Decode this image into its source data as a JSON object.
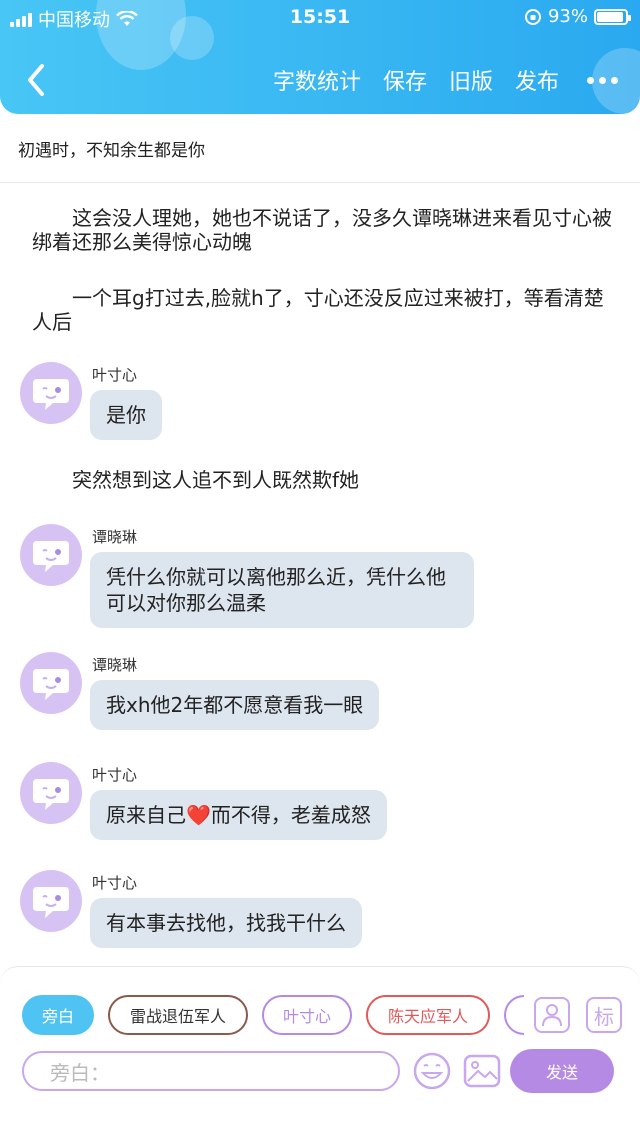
{
  "status_bar": {
    "carrier": "中国移动",
    "time": "15:51",
    "battery": "93%",
    "battery_level": 0.93
  },
  "header": {
    "actions": [
      "字数统计",
      "保存",
      "旧版",
      "发布"
    ]
  },
  "chapter_title": "初遇时，不知余生都是你",
  "narrations": [
    "这会没人理她，她也不说话了，没多久谭晓琳进来看见寸心被绑着还那么美得惊心动魄",
    "一个耳g打过去,脸就h了，寸心还没反应过来被打，等看清楚人后",
    "突然想到这人追不到人既然欺f她"
  ],
  "messages": [
    {
      "name": "叶寸心",
      "text": "是你"
    },
    {
      "name": "谭晓琳",
      "text": "凭什么你就可以离他那么近，凭什么他可以对你那么温柔"
    },
    {
      "name": "谭晓琳",
      "text": "我xh他2年都不愿意看我一眼"
    },
    {
      "name": "叶寸心",
      "text_before": "原来自己",
      "emoji": "❤️",
      "text_after": "而不得，老羞成怒"
    },
    {
      "name": "叶寸心",
      "text": "有本事去找他，找我干什么"
    }
  ],
  "roles": [
    {
      "label": "旁白",
      "color": "#4fc3f2"
    },
    {
      "label": "雷战退伍军人",
      "color": "#8a5a4a"
    },
    {
      "label": "叶寸心",
      "color": "#b58ae4"
    },
    {
      "label": "陈天应军人",
      "color": "#e05a5a"
    }
  ],
  "tag_button": "标",
  "input": {
    "placeholder": "旁白："
  },
  "send_label": "发送",
  "colors": {
    "header": "#2aa9f0",
    "accent_purple": "#b58ae4",
    "bubble": "#dde5ee"
  }
}
